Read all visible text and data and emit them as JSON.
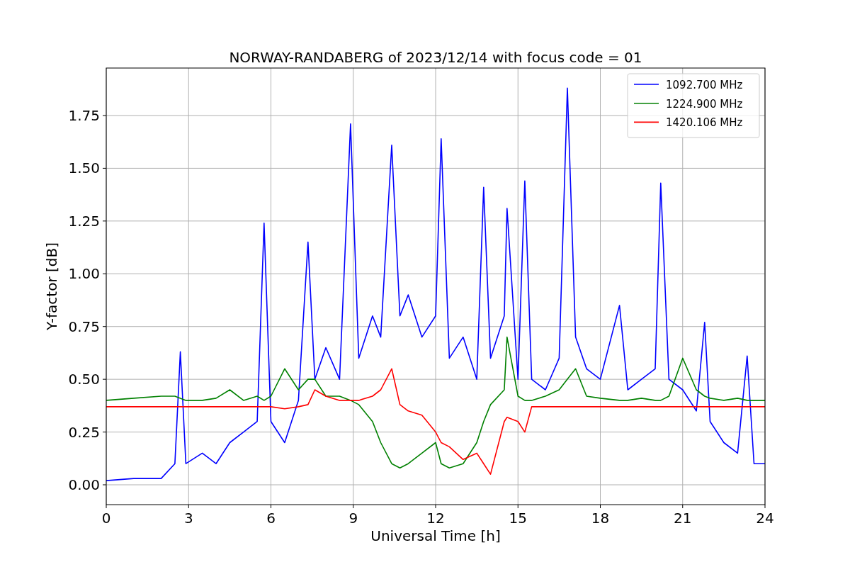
{
  "figure": {
    "chart_data": {
      "type": "line",
      "title": "NORWAY-RANDABERG of 2023/12/14 with focus code = 01",
      "xlabel": "Universal Time [h]",
      "ylabel": "Y-factor [dB]",
      "x": [
        0,
        1,
        2,
        2.5,
        2.7,
        2.9,
        3.5,
        4,
        4.5,
        5,
        5.5,
        5.75,
        6,
        6.5,
        7,
        7.35,
        7.6,
        8,
        8.5,
        8.9,
        9.2,
        9.7,
        10,
        10.4,
        10.7,
        11,
        11.5,
        12,
        12.2,
        12.5,
        13,
        13.5,
        13.75,
        14,
        14.5,
        14.6,
        15,
        15.25,
        15.5,
        16,
        16.5,
        16.8,
        17.1,
        17.5,
        18,
        18.7,
        19,
        19.5,
        20,
        20.2,
        20.5,
        21,
        21.5,
        21.8,
        22,
        22.5,
        23,
        23.35,
        23.6,
        24
      ],
      "series": [
        {
          "name": "1092.700 MHz",
          "color": "#0000ff",
          "values": [
            0.02,
            0.03,
            0.03,
            0.1,
            0.63,
            0.1,
            0.15,
            0.1,
            0.2,
            0.25,
            0.3,
            1.24,
            0.3,
            0.2,
            0.4,
            1.15,
            0.5,
            0.65,
            0.5,
            1.71,
            0.6,
            0.8,
            0.7,
            1.61,
            0.8,
            0.9,
            0.7,
            0.8,
            1.64,
            0.6,
            0.7,
            0.5,
            1.41,
            0.6,
            0.8,
            1.31,
            0.5,
            1.44,
            0.5,
            0.45,
            0.6,
            1.88,
            0.7,
            0.55,
            0.5,
            0.85,
            0.45,
            0.5,
            0.55,
            1.43,
            0.5,
            0.45,
            0.35,
            0.77,
            0.3,
            0.2,
            0.15,
            0.61,
            0.1,
            0.1
          ]
        },
        {
          "name": "1224.900 MHz",
          "color": "#008000",
          "values": [
            0.4,
            0.41,
            0.42,
            0.42,
            0.41,
            0.4,
            0.4,
            0.41,
            0.45,
            0.4,
            0.42,
            0.4,
            0.42,
            0.55,
            0.45,
            0.5,
            0.5,
            0.42,
            0.42,
            0.4,
            0.38,
            0.3,
            0.2,
            0.1,
            0.08,
            0.1,
            0.15,
            0.2,
            0.1,
            0.08,
            0.1,
            0.2,
            0.3,
            0.38,
            0.45,
            0.7,
            0.42,
            0.4,
            0.4,
            0.42,
            0.45,
            0.5,
            0.55,
            0.42,
            0.41,
            0.4,
            0.4,
            0.41,
            0.4,
            0.4,
            0.42,
            0.6,
            0.45,
            0.42,
            0.41,
            0.4,
            0.41,
            0.4,
            0.4,
            0.4
          ]
        },
        {
          "name": "1420.106 MHz",
          "color": "#ff0000",
          "values": [
            0.37,
            0.37,
            0.37,
            0.37,
            0.37,
            0.37,
            0.37,
            0.37,
            0.37,
            0.37,
            0.37,
            0.37,
            0.37,
            0.36,
            0.37,
            0.38,
            0.45,
            0.42,
            0.4,
            0.4,
            0.4,
            0.42,
            0.45,
            0.55,
            0.38,
            0.35,
            0.33,
            0.25,
            0.2,
            0.18,
            0.12,
            0.15,
            0.1,
            0.05,
            0.3,
            0.32,
            0.3,
            0.25,
            0.37,
            0.37,
            0.37,
            0.37,
            0.37,
            0.37,
            0.37,
            0.37,
            0.37,
            0.37,
            0.37,
            0.37,
            0.37,
            0.37,
            0.37,
            0.37,
            0.37,
            0.37,
            0.37,
            0.37,
            0.37,
            0.37
          ]
        }
      ],
      "grid": true,
      "legend": "upper right",
      "xlim": [
        0,
        24
      ],
      "ylim": [
        -0.094,
        1.975
      ],
      "xticks": [
        0,
        3,
        6,
        9,
        12,
        15,
        18,
        21,
        24
      ],
      "yticks": [
        {
          "value": 0,
          "label": "0.00"
        },
        {
          "value": 0.25,
          "label": "0.25"
        },
        {
          "value": 0.5,
          "label": "0.50"
        },
        {
          "value": 0.75,
          "label": "0.75"
        },
        {
          "value": 1,
          "label": "1.00"
        },
        {
          "value": 1.25,
          "label": "1.25"
        },
        {
          "value": 1.5,
          "label": "1.50"
        },
        {
          "value": 1.75,
          "label": "1.75"
        }
      ]
    }
  }
}
